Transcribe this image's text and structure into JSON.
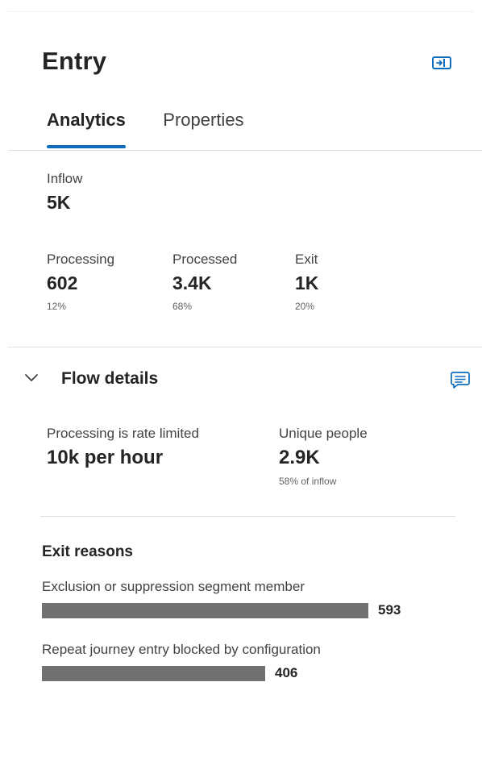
{
  "panel": {
    "title": "Entry",
    "collapse_icon": "panel-collapse-icon"
  },
  "tabs": [
    {
      "label": "Analytics",
      "active": true
    },
    {
      "label": "Properties",
      "active": false
    }
  ],
  "inflow": {
    "label": "Inflow",
    "value": "5K"
  },
  "stats": [
    {
      "label": "Processing",
      "value": "602",
      "percent": "12%"
    },
    {
      "label": "Processed",
      "value": "3.4K",
      "percent": "68%"
    },
    {
      "label": "Exit",
      "value": "1K",
      "percent": "20%"
    }
  ],
  "flow_details": {
    "title": "Flow details",
    "expanded": true,
    "rate_limit": {
      "label": "Processing is rate limited",
      "value": "10k per hour"
    },
    "unique_people": {
      "label": "Unique people",
      "value": "2.9K",
      "sub": "58% of inflow"
    }
  },
  "exit_reasons": {
    "title": "Exit reasons",
    "items": [
      {
        "label": "Exclusion or suppression segment member",
        "count": "593",
        "value": 593
      },
      {
        "label": "Repeat journey entry blocked by configuration",
        "count": "406",
        "value": 406
      }
    ]
  },
  "colors": {
    "accent": "#0f6cbd",
    "bar": "#717171"
  }
}
